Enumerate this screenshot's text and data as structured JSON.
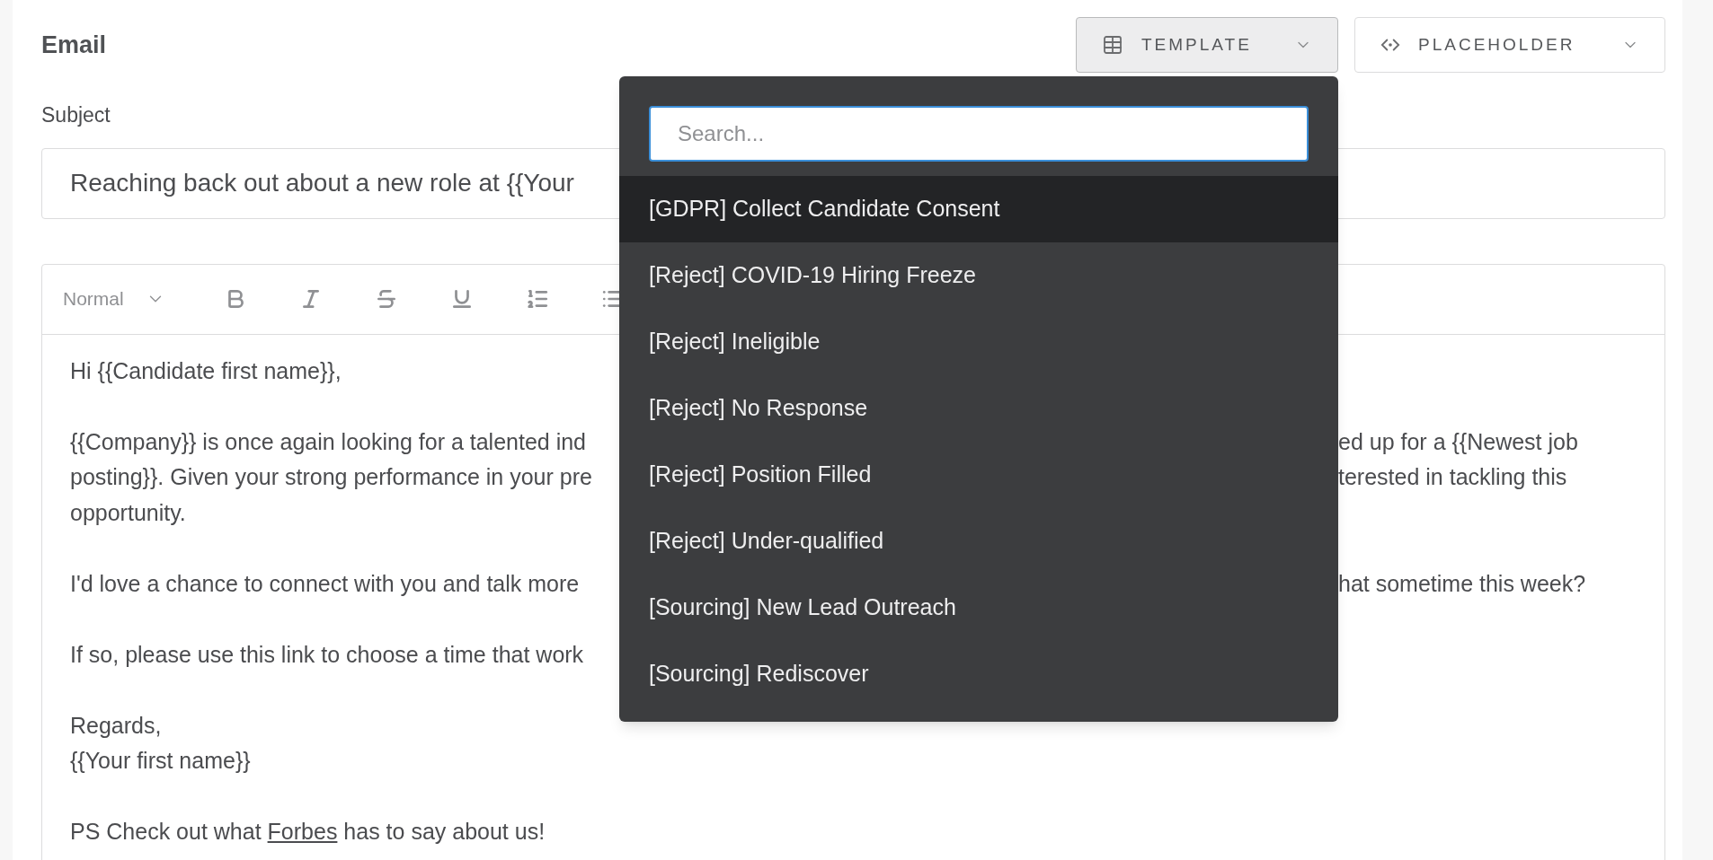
{
  "section": {
    "title": "Email"
  },
  "header_buttons": [
    {
      "kind": "template",
      "label": "TEMPLATE",
      "pressed": true
    },
    {
      "kind": "placeholder",
      "label": "PLACEHOLDER",
      "pressed": false
    }
  ],
  "subject": {
    "label": "Subject",
    "value": "Reaching back out about a new role at {{Your"
  },
  "toolbar": {
    "style": "Normal",
    "tools": [
      {
        "kind": "bold"
      },
      {
        "kind": "italic"
      },
      {
        "kind": "strike"
      },
      {
        "kind": "underline"
      },
      {
        "kind": "ordered"
      },
      {
        "kind": "bullets"
      }
    ]
  },
  "body": {
    "paragraphs": [
      [
        {
          "left": "Hi {{Candidate first name}},"
        }
      ],
      [
        {
          "left": "{{Company}} is once again looking for a talented ind",
          "right": "ed up for a {{Newest job"
        },
        {
          "left": "posting}}. Given your strong performance in your pre",
          "right": "terested in tackling this"
        },
        {
          "left": "opportunity."
        }
      ],
      [
        {
          "left": "I'd love a chance to connect with you and talk more",
          "right": "hat sometime this week?"
        }
      ],
      [
        {
          "left": "If so, please use this link to choose a time that work"
        }
      ],
      [
        {
          "left": "Regards,"
        },
        {
          "left": "{{Your first name}}"
        }
      ]
    ],
    "ps": {
      "before": "PS Check out what",
      "link": "Forbes",
      "after": "has to say about us!"
    }
  },
  "template_menu": {
    "search_placeholder": "Search...",
    "items": [
      {
        "label": "[GDPR] Collect Candidate Consent",
        "selected": true
      },
      {
        "label": "[Reject] COVID-19 Hiring Freeze",
        "selected": false
      },
      {
        "label": "[Reject] Ineligible",
        "selected": false
      },
      {
        "label": "[Reject] No Response",
        "selected": false
      },
      {
        "label": "[Reject] Position Filled",
        "selected": false
      },
      {
        "label": "[Reject] Under-qualified",
        "selected": false
      },
      {
        "label": "[Sourcing] New Lead Outreach",
        "selected": false
      },
      {
        "label": "[Sourcing] Rediscover",
        "selected": false
      }
    ]
  }
}
